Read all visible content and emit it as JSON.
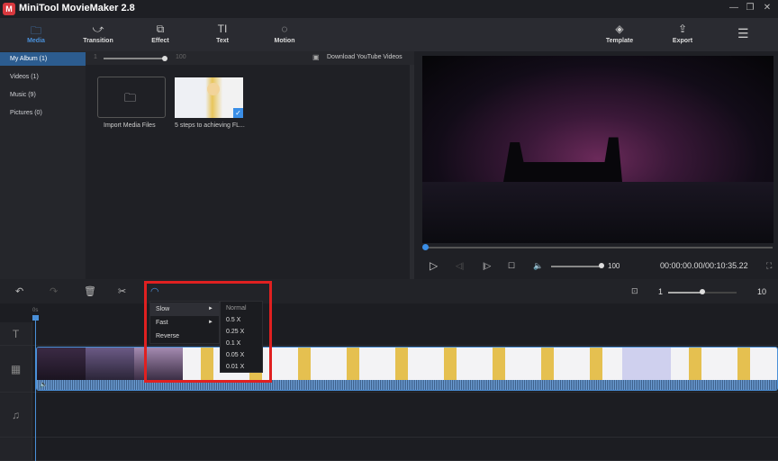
{
  "app": {
    "title": "MiniTool MovieMaker 2.8",
    "logo_letter": "M"
  },
  "window_controls": [
    "minimize",
    "restore",
    "close"
  ],
  "toolbar": {
    "items": [
      {
        "label": "Media",
        "icon": "folder-icon",
        "glyph": "🗀",
        "active": true
      },
      {
        "label": "Transition",
        "icon": "transition-icon",
        "glyph": "⤻"
      },
      {
        "label": "Effect",
        "icon": "effect-icon",
        "glyph": "⧉"
      },
      {
        "label": "Text",
        "icon": "text-icon",
        "glyph": "TI"
      },
      {
        "label": "Motion",
        "icon": "motion-icon",
        "glyph": "◌"
      }
    ],
    "right": [
      {
        "label": "Template",
        "icon": "layers-icon",
        "glyph": "◈"
      },
      {
        "label": "Export",
        "icon": "export-icon",
        "glyph": "⇪"
      }
    ],
    "menu_glyph": "☰"
  },
  "sidebar": {
    "items": [
      {
        "label": "My Album  (1)",
        "selected": true
      },
      {
        "label": "Videos  (1)"
      },
      {
        "label": "Music  (9)"
      },
      {
        "label": "Pictures  (0)"
      }
    ]
  },
  "media": {
    "zoom_min": "1",
    "zoom_max": "100",
    "download_label": "Download YouTube Videos",
    "import_label": "Import Media Files",
    "clip_label": "5 steps to achieving FL..."
  },
  "preview": {
    "volume": "100",
    "time": "00:00:00.00/00:10:35.22",
    "progress": 0.0
  },
  "timeline": {
    "ruler_start": "0s",
    "zoom_min": "1",
    "zoom_max": "10",
    "zoom_value": 0.33
  },
  "speed_menu": {
    "items": [
      {
        "label": "Slow",
        "has_submenu": true
      },
      {
        "label": "Fast",
        "has_submenu": true
      },
      {
        "label": "Reverse"
      }
    ],
    "submenu": [
      "Normal",
      "0.5 X",
      "0.25 X",
      "0.1 X",
      "0.05 X",
      "0.01 X"
    ],
    "arrow": "►"
  },
  "colors": {
    "accent": "#4a90d9",
    "highlight_box": "#e02020"
  }
}
